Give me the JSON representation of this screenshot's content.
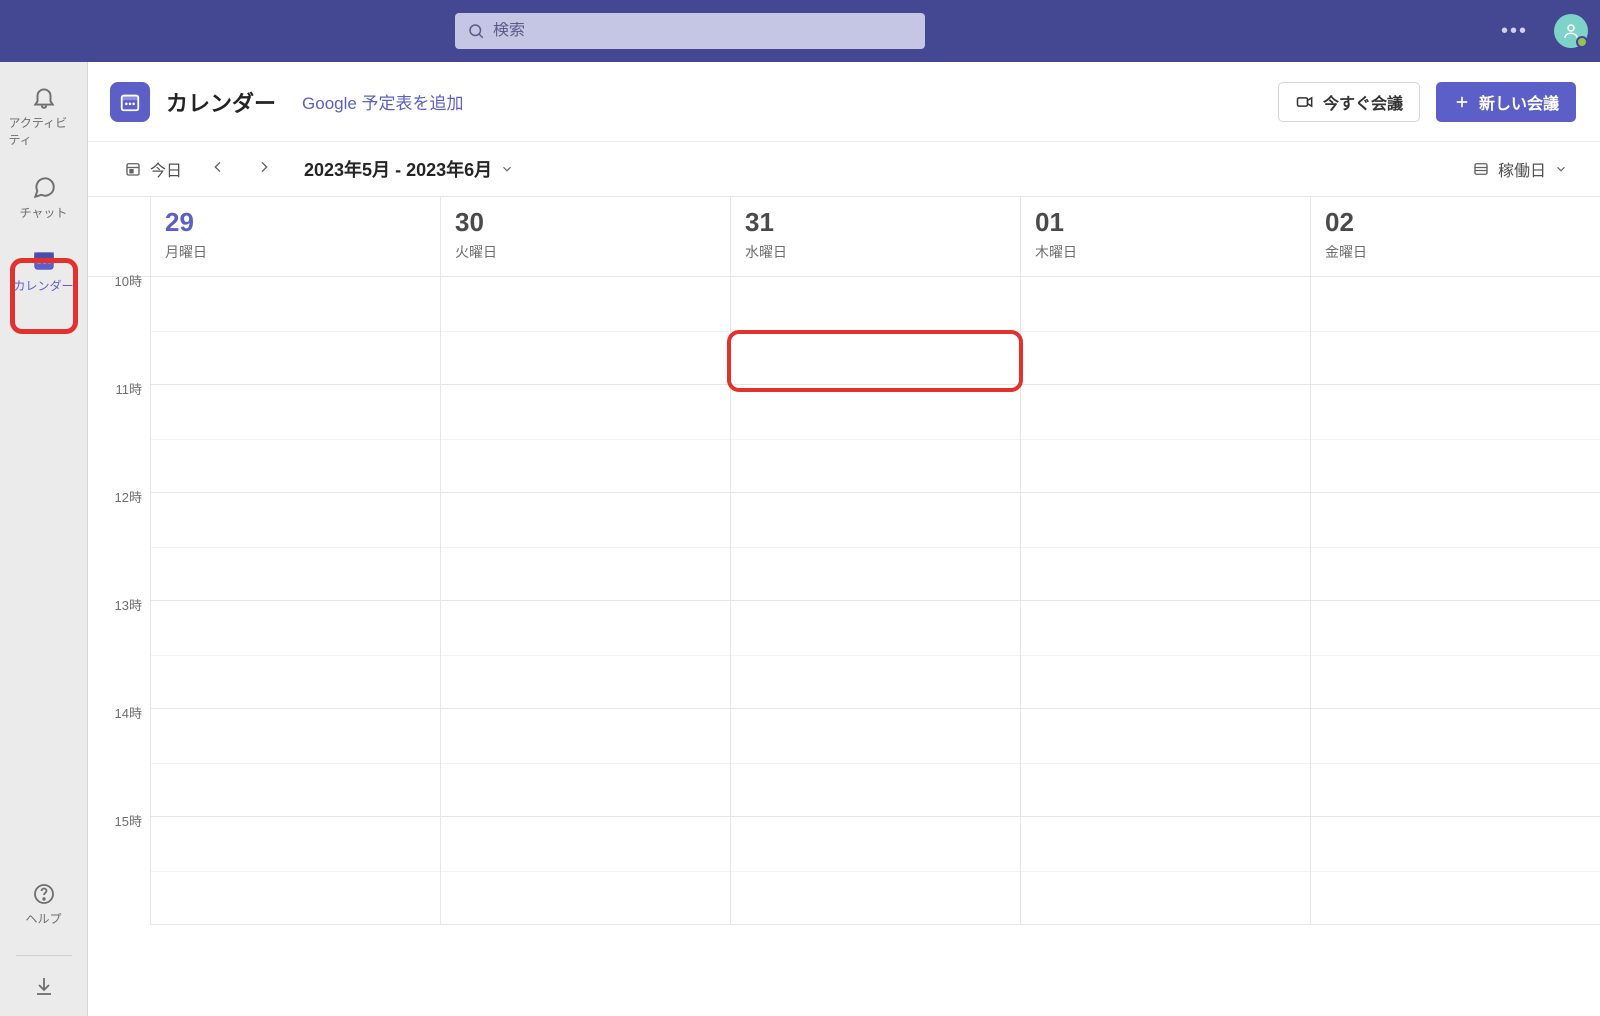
{
  "titlebar": {
    "search_placeholder": "検索"
  },
  "rail": {
    "items": [
      {
        "id": "activity",
        "label": "アクティビティ"
      },
      {
        "id": "chat",
        "label": "チャット"
      },
      {
        "id": "calendar",
        "label": "カレンダー"
      }
    ],
    "help_label": "ヘルプ"
  },
  "header": {
    "title": "カレンダー",
    "google_link": "Google 予定表を追加",
    "meet_now": "今すぐ会議",
    "new_meeting": "新しい会議"
  },
  "toolbar": {
    "today": "今日",
    "range": "2023年5月 - 2023年6月",
    "view_label": "稼働日"
  },
  "calendar": {
    "days": [
      {
        "num": "29",
        "dow": "月曜日",
        "today": true
      },
      {
        "num": "30",
        "dow": "火曜日",
        "today": false
      },
      {
        "num": "31",
        "dow": "水曜日",
        "today": false
      },
      {
        "num": "01",
        "dow": "木曜日",
        "today": false
      },
      {
        "num": "02",
        "dow": "金曜日",
        "today": false
      }
    ],
    "hours": [
      "10時",
      "11時",
      "12時",
      "13時",
      "14時",
      "15時"
    ]
  }
}
